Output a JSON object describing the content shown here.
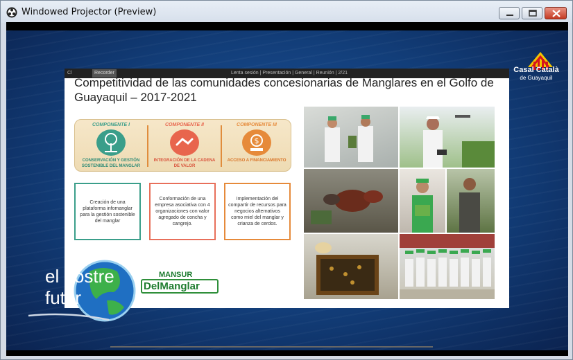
{
  "window": {
    "title": "Windowed Projector (Preview)"
  },
  "slide": {
    "toolbar_items": [
      "Cl",
      "Recorder",
      "Lenta sesión | Presentación | General | Reunión | 2/21"
    ],
    "title_line1": "Competitividad de las comunidades concesionarias de Manglares en el Golfo de",
    "title_line2": "Guayaquil – 2017-2021",
    "components": [
      {
        "head": "COMPONENTE I",
        "label": "CONSERVACIÓN Y GESTIÓN SOSTENIBLE DEL MANGLAR",
        "color": "#3a9e8a"
      },
      {
        "head": "COMPONENTE II",
        "label": "INTEGRACIÓN DE LA CADENA DE VALOR",
        "color": "#e8654d"
      },
      {
        "head": "COMPONENTE III",
        "label": "ACCESO A FINANCIAMIENTO",
        "color": "#e68a3a"
      }
    ],
    "descriptions": [
      {
        "text": "Creación de una plataforma infomanglar para la gestión sostenible del manglar",
        "color": "#3a9e8a"
      },
      {
        "text": "Conformación de una empresa asociativa con 4 organizaciones con valor agregado de concha y cangrejo.",
        "color": "#e86f5a"
      },
      {
        "text": "Implementación del compartir de recursos para negocios alternativos como miel del manglar y crianza de cerdos.",
        "color": "#e68a3a"
      }
    ],
    "mansur_top": "MANSUR",
    "mansur_bottom": "DelManglar"
  },
  "overlay": {
    "casal_name": "Casal Català",
    "casal_sub": "de Guayaquil",
    "nostre_line1": "el nostre",
    "nostre_line2": "futur"
  }
}
